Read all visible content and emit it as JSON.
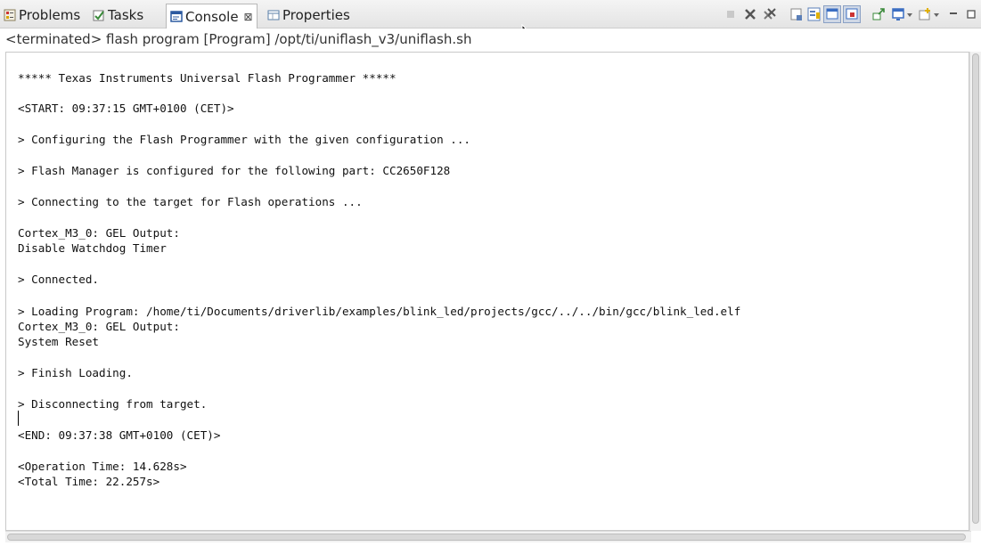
{
  "tabs": [
    {
      "label": "Problems",
      "icon": "problems-icon",
      "active": false
    },
    {
      "label": "Tasks",
      "icon": "tasks-icon",
      "active": false
    },
    {
      "label": "Console",
      "icon": "console-icon",
      "active": true,
      "close": "⊠"
    },
    {
      "label": "Properties",
      "icon": "properties-icon",
      "active": false
    }
  ],
  "toolbar": {
    "icons": [
      "terminate-icon",
      "remove-launch-icon",
      "remove-all-terminated-icon",
      "clear-console-icon",
      "scroll-lock-icon",
      "show-on-stdout-icon",
      "show-on-stderr-icon",
      "pin-console-icon",
      "display-console-icon",
      "open-console-icon",
      "minimize-icon",
      "maximize-icon"
    ]
  },
  "console": {
    "title": "<terminated> flash program [Program] /opt/ti/uniflash_v3/uniflash.sh",
    "lines": [
      "***** Texas Instruments Universal Flash Programmer *****",
      "",
      "<START: 09:37:15 GMT+0100 (CET)>",
      "",
      "> Configuring the Flash Programmer with the given configuration ...",
      "",
      "> Flash Manager is configured for the following part: CC2650F128",
      "",
      "> Connecting to the target for Flash operations ...",
      "",
      "Cortex_M3_0: GEL Output:",
      "Disable Watchdog Timer",
      "",
      "> Connected.",
      "",
      "> Loading Program: /home/ti/Documents/driverlib/examples/blink_led/projects/gcc/../../bin/gcc/blink_led.elf",
      "Cortex_M3_0: GEL Output:",
      "System Reset",
      "",
      "> Finish Loading.",
      "",
      "> Disconnecting from target.",
      "",
      "<END: 09:37:38 GMT+0100 (CET)>",
      "",
      "<Operation Time: 14.628s>",
      "<Total Time: 22.257s>"
    ]
  },
  "colors": {
    "accent": "#3b6ec2",
    "tabbar_bg": "#e8e8e8",
    "console_bg": "#ffffff",
    "text": "#111111"
  }
}
